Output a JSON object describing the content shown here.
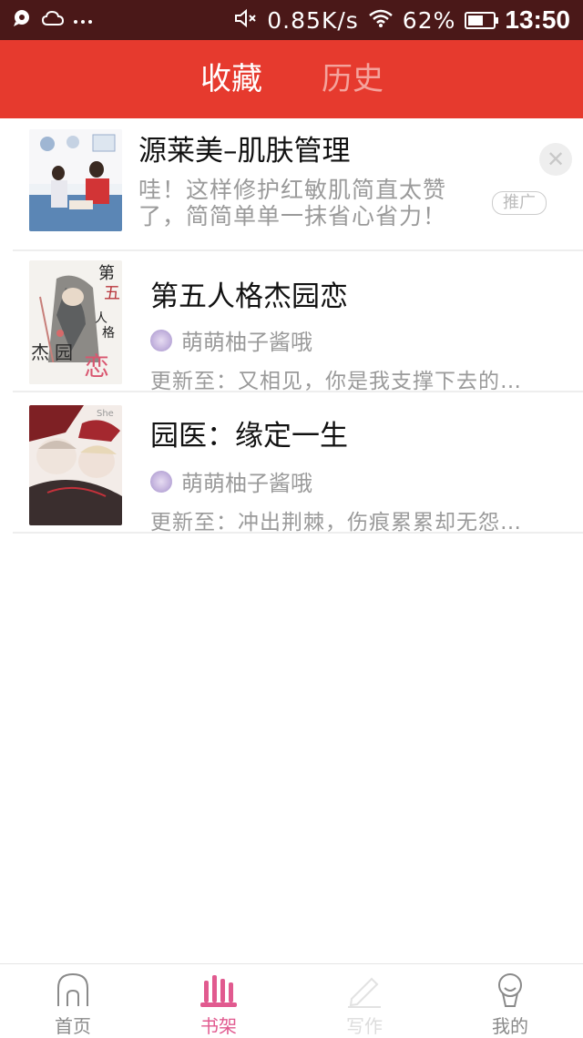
{
  "status_bar": {
    "network_speed": "0.85K/s",
    "battery": "62%",
    "battery_level": 0.62,
    "time": "13:50"
  },
  "header": {
    "tabs": [
      {
        "label": "收藏",
        "active": true
      },
      {
        "label": "历史",
        "active": false
      }
    ]
  },
  "list": {
    "ad": {
      "title": "源莱美–肌肤管理",
      "description": "哇！这样修护红敏肌简直太赞了，简简单单一抹省心省力！",
      "badge": "推广",
      "close_icon": "close-icon"
    },
    "items": [
      {
        "title": "第五人格杰园恋",
        "author": "萌萌柚子酱哦",
        "update": "更新至：又相见，你是我支撑下去的…",
        "cover_text": [
          "第",
          "五",
          "人",
          "格",
          "杰",
          "园",
          "恋"
        ]
      },
      {
        "title": "园医：缘定一生",
        "author": "萌萌柚子酱哦",
        "update": "更新至：冲出荆棘，伤痕累累却无怨…",
        "cover_text": [
          "She"
        ]
      }
    ]
  },
  "bottom_nav": {
    "items": [
      {
        "label": "首页",
        "icon": "home-icon"
      },
      {
        "label": "书架",
        "icon": "bookshelf-icon",
        "active": true
      },
      {
        "label": "写作",
        "icon": "pencil-icon"
      },
      {
        "label": "我的",
        "icon": "profile-icon"
      }
    ]
  },
  "colors": {
    "header_bg": "#e63a2e",
    "status_bg": "#4a1818",
    "active_nav": "#e15a8f"
  }
}
